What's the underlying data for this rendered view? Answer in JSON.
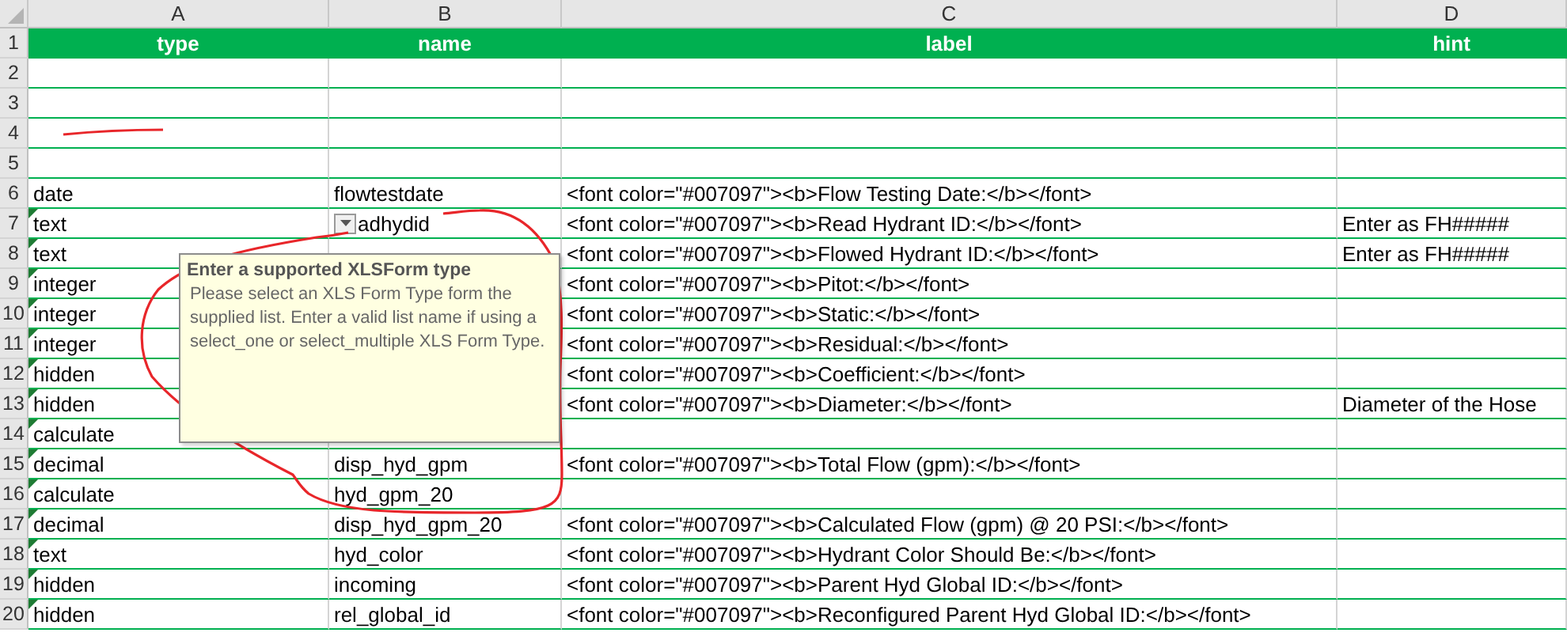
{
  "columns": [
    {
      "letter": "A",
      "heading": "type"
    },
    {
      "letter": "B",
      "heading": "name"
    },
    {
      "letter": "C",
      "heading": "label"
    },
    {
      "letter": "D",
      "heading": "hint"
    }
  ],
  "header_row": {
    "number": "1"
  },
  "rows": [
    {
      "number": "2",
      "flag": false
    },
    {
      "number": "3",
      "flag": false
    },
    {
      "number": "4",
      "flag": false
    },
    {
      "number": "5",
      "flag": false
    },
    {
      "number": "6",
      "flag": false,
      "type": "date",
      "name": "flowtestdate",
      "label": "<font color=\"#007097\"><b>Flow Testing Date:</b></font>"
    },
    {
      "number": "7",
      "flag": true,
      "type": "text",
      "name": "adhydid",
      "dropdown": true,
      "label": "<font color=\"#007097\"><b>Read Hydrant ID:</b></font>",
      "hint": "Enter as FH#####"
    },
    {
      "number": "8",
      "flag": true,
      "type": "text",
      "label": "<font color=\"#007097\"><b>Flowed Hydrant ID:</b></font>",
      "hint": "Enter as FH#####"
    },
    {
      "number": "9",
      "flag": true,
      "type": "integer",
      "label": "<font color=\"#007097\"><b>Pitot:</b></font>"
    },
    {
      "number": "10",
      "flag": true,
      "type": "integer",
      "label": "<font color=\"#007097\"><b>Static:</b></font>"
    },
    {
      "number": "11",
      "flag": true,
      "type": "integer",
      "label": "<font color=\"#007097\"><b>Residual:</b></font>"
    },
    {
      "number": "12",
      "flag": true,
      "type": "hidden",
      "label": "<font color=\"#007097\"><b>Coefficient:</b></font>"
    },
    {
      "number": "13",
      "flag": true,
      "type": "hidden",
      "label": "<font color=\"#007097\"><b>Diameter:</b></font>",
      "hint": "Diameter of the Hose"
    },
    {
      "number": "14",
      "flag": true,
      "type": "calculate"
    },
    {
      "number": "15",
      "flag": true,
      "type": "decimal",
      "name": "disp_hyd_gpm",
      "label": "<font color=\"#007097\"><b>Total Flow (gpm):</b></font>"
    },
    {
      "number": "16",
      "flag": true,
      "type": "calculate",
      "name": "hyd_gpm_20"
    },
    {
      "number": "17",
      "flag": true,
      "type": "decimal",
      "name": "disp_hyd_gpm_20",
      "label": "<font color=\"#007097\"><b>Calculated Flow (gpm) @ 20 PSI:</b></font>"
    },
    {
      "number": "18",
      "flag": true,
      "type": "text",
      "name": "hyd_color",
      "label": "<font color=\"#007097\"><b>Hydrant Color Should Be:</b></font>"
    },
    {
      "number": "19",
      "flag": true,
      "type": "hidden",
      "name": "incoming",
      "label": "<font color=\"#007097\"><b>Parent Hyd Global ID:</b></font>"
    },
    {
      "number": "20",
      "flag": true,
      "type": "hidden",
      "name": "rel_global_id",
      "label": "<font color=\"#007097\"><b>Reconfigured Parent Hyd Global ID:</b></font>"
    }
  ],
  "tooltip": {
    "title": "Enter a supported XLSForm type",
    "text": "Please select an XLS Form Type form the supplied list. Enter a valid list name if using a select_one or select_multiple XLS Form Type."
  }
}
